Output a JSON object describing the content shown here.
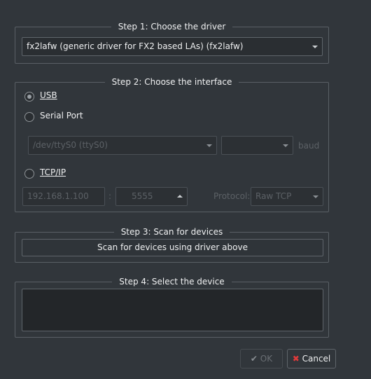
{
  "step1": {
    "title": "Step 1: Choose the driver",
    "driver_selected": "fx2lafw (generic driver for FX2 based LAs) (fx2lafw)"
  },
  "step2": {
    "title": "Step 2: Choose the interface",
    "usb_label": "USB",
    "usb_checked": true,
    "serial_label": "Serial Port",
    "serial_port_value": "/dev/ttyS0 (ttyS0)",
    "baud_value": "",
    "baud_label": "baud",
    "tcp_label": "TCP/IP",
    "host_placeholder": "192.168.1.100",
    "colon": ":",
    "port_value": "5555",
    "protocol_label": "Protocol:",
    "protocol_value": "Raw TCP"
  },
  "step3": {
    "title": "Step 3: Scan for devices",
    "scan_button_label": "Scan for devices using driver above"
  },
  "step4": {
    "title": "Step 4: Select the device"
  },
  "buttons": {
    "ok_label": "OK",
    "cancel_label": "Cancel"
  },
  "icons": {
    "ok": "check-icon",
    "cancel": "x-icon"
  }
}
